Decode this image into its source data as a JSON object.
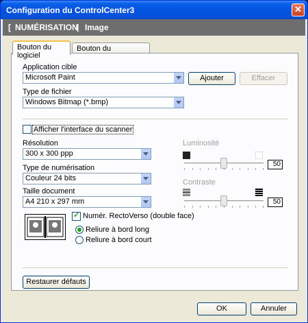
{
  "window": {
    "title": "Configuration du ControlCenter3"
  },
  "header": {
    "open_bracket": "[",
    "section": "NUMÉRISATION",
    "pipe": "|",
    "subsection": "Image"
  },
  "tabs": [
    {
      "label": "Bouton du logiciel"
    },
    {
      "label": "Bouton du périphérique"
    }
  ],
  "app": {
    "label": "Application cible",
    "value": "Microsoft Paint",
    "add_label": "Ajouter",
    "remove_label": "Effacer"
  },
  "filetype": {
    "label": "Type de fichier",
    "value": "Windows Bitmap (*.bmp)"
  },
  "scanner_ui": {
    "label": "Afficher l'interface du scanner",
    "checked": false
  },
  "resolution": {
    "label": "Résolution",
    "value": "300 x 300 ppp"
  },
  "scan_type": {
    "label": "Type de numérisation",
    "value": "Couleur 24 bits"
  },
  "doc_size": {
    "label": "Taille document",
    "value": "A4 210 x 297 mm"
  },
  "duplex": {
    "label": "Numér. RectoVerso (double face)",
    "checked": true,
    "opt_long": "Reliure à bord long",
    "opt_short": "Reliure à bord court",
    "selected": "long"
  },
  "brightness": {
    "label": "Luminosité",
    "value": "50",
    "level": 0.5
  },
  "contrast": {
    "label": "Contraste",
    "value": "50",
    "level": 0.5
  },
  "restore_label": "Restaurer défauts",
  "ok_label": "OK",
  "cancel_label": "Annuler"
}
